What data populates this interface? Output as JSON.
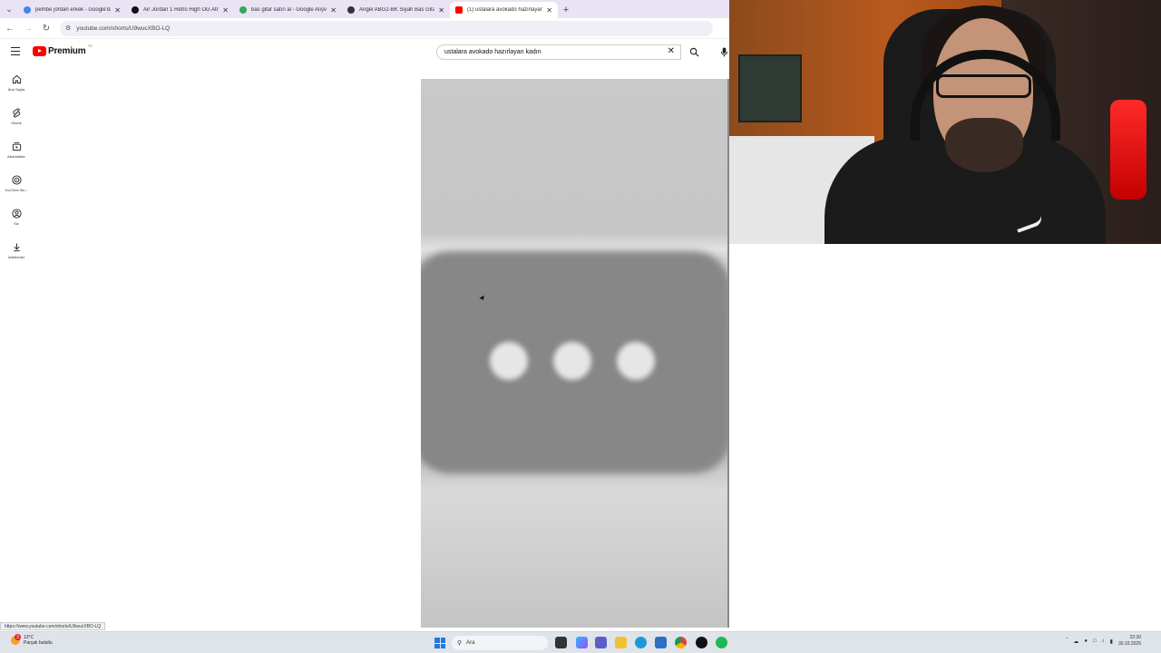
{
  "browser": {
    "tabs": [
      {
        "label": "pembe jordan erkek - Google'da",
        "favicon_color": "#4285f4",
        "active": false
      },
      {
        "label": "Air Jordan 1 Retro High OG Atm",
        "favicon_color": "#111111",
        "active": false
      },
      {
        "label": "bas gitar satın al - Google Alışv",
        "favicon_color": "#34a853",
        "active": false
      },
      {
        "label": "Angel ABG2-BK Siyah Bas Gitar",
        "favicon_color": "#333333",
        "active": false
      },
      {
        "label": "(1) ustalara avokado hazırlayan",
        "favicon_color": "#ff0000",
        "active": true
      }
    ],
    "url": "youtube.com/shorts/U9wucXBO-LQ"
  },
  "youtube": {
    "logo_text": "Premium",
    "logo_sup": "TR",
    "search_query": "ustalara avokado hazırlayan kadın",
    "sidebar": [
      {
        "label": "Ana Sayfa",
        "icon": "home-icon"
      },
      {
        "label": "Shorts",
        "icon": "shorts-icon"
      },
      {
        "label": "Abonelikler",
        "icon": "subscriptions-icon"
      },
      {
        "label": "YouTube Mu...",
        "icon": "youtube-music-icon"
      },
      {
        "label": "Siz",
        "icon": "you-icon"
      },
      {
        "label": "İndirilenler",
        "icon": "downloads-icon"
      }
    ],
    "status_url": "https://www.youtube.com/shorts/U9wucXBO-LQ"
  },
  "taskbar": {
    "weather_temp": "13°C",
    "weather_desc": "Parçalı bulutlu",
    "weather_badge": "3",
    "search_placeholder": "Ara",
    "time": "22:30",
    "date": "30.10.2025"
  },
  "colors": {
    "brand_red": "#ff0000",
    "tab_bar": "#e9e3f3",
    "taskbar": "#dfe3ea"
  }
}
